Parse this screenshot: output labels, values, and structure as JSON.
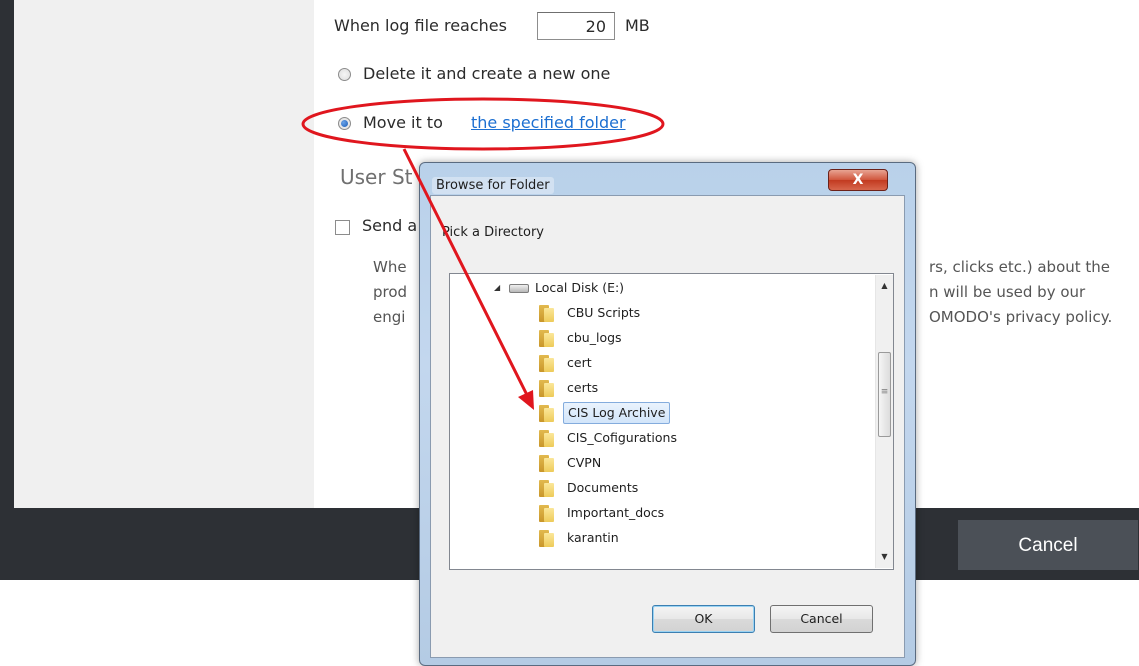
{
  "settings": {
    "log_limit_prefix": "When log file reaches",
    "log_limit_value": "20",
    "log_limit_unit": "MB",
    "option_delete": "Delete it and create a new one",
    "option_move_prefix": "Move it to",
    "option_move_link": "the specified folder",
    "section_title": "User St",
    "send_prefix": "Send a",
    "desc_line1_start": "Whe",
    "desc_line1_end": "rs, clicks etc.) about the",
    "desc_line2_start": "prod",
    "desc_line2_end": "n will be used by our",
    "desc_line3_start": "engi",
    "desc_line3_end": "OMODO's privacy policy."
  },
  "footer": {
    "cancel_label": "Cancel"
  },
  "dialog": {
    "title": "Browse for Folder",
    "close_label": "X",
    "prompt": "Pick a Directory",
    "ok_label": "OK",
    "cancel_label": "Cancel",
    "tree": {
      "root": "Local Disk (E:)",
      "folders": [
        "CBU Scripts",
        "cbu_logs",
        "cert",
        "certs",
        "CIS Log Archive",
        "CIS_Cofigurations",
        "CVPN",
        "Documents",
        "Important_docs",
        "karantin"
      ],
      "selected": "CIS Log Archive"
    }
  },
  "colors": {
    "annotation": "#e0161e",
    "link": "#1c6fd1",
    "dark_bar": "#2d3035"
  }
}
